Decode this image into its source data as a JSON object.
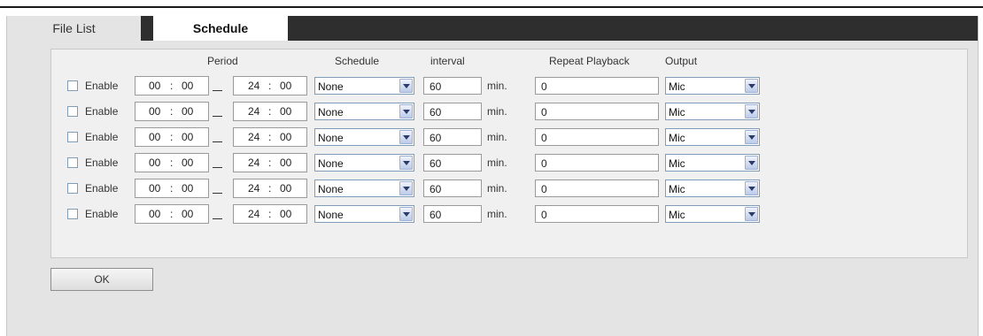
{
  "tabs": [
    {
      "label": "File List",
      "active": false
    },
    {
      "label": "Schedule",
      "active": true
    }
  ],
  "headers": {
    "period": "Period",
    "schedule": "Schedule",
    "interval": "interval",
    "repeat": "Repeat Playback",
    "output": "Output"
  },
  "rows": [
    {
      "enable_label": "Enable",
      "checked": false,
      "start_h": "00",
      "start_m": "00",
      "end_h": "24",
      "end_m": "00",
      "schedule": "None",
      "interval": "60",
      "unit": "min.",
      "repeat": "0",
      "output": "Mic"
    },
    {
      "enable_label": "Enable",
      "checked": false,
      "start_h": "00",
      "start_m": "00",
      "end_h": "24",
      "end_m": "00",
      "schedule": "None",
      "interval": "60",
      "unit": "min.",
      "repeat": "0",
      "output": "Mic"
    },
    {
      "enable_label": "Enable",
      "checked": false,
      "start_h": "00",
      "start_m": "00",
      "end_h": "24",
      "end_m": "00",
      "schedule": "None",
      "interval": "60",
      "unit": "min.",
      "repeat": "0",
      "output": "Mic"
    },
    {
      "enable_label": "Enable",
      "checked": false,
      "start_h": "00",
      "start_m": "00",
      "end_h": "24",
      "end_m": "00",
      "schedule": "None",
      "interval": "60",
      "unit": "min.",
      "repeat": "0",
      "output": "Mic"
    },
    {
      "enable_label": "Enable",
      "checked": false,
      "start_h": "00",
      "start_m": "00",
      "end_h": "24",
      "end_m": "00",
      "schedule": "None",
      "interval": "60",
      "unit": "min.",
      "repeat": "0",
      "output": "Mic"
    },
    {
      "enable_label": "Enable",
      "checked": false,
      "start_h": "00",
      "start_m": "00",
      "end_h": "24",
      "end_m": "00",
      "schedule": "None",
      "interval": "60",
      "unit": "min.",
      "repeat": "0",
      "output": "Mic"
    }
  ],
  "time_separator": ":",
  "ok_label": "OK",
  "colors": {
    "tab_bar": "#2e2e2e",
    "panel": "#e4e4e4",
    "dropdown_arrow": "#2b3c6b"
  }
}
